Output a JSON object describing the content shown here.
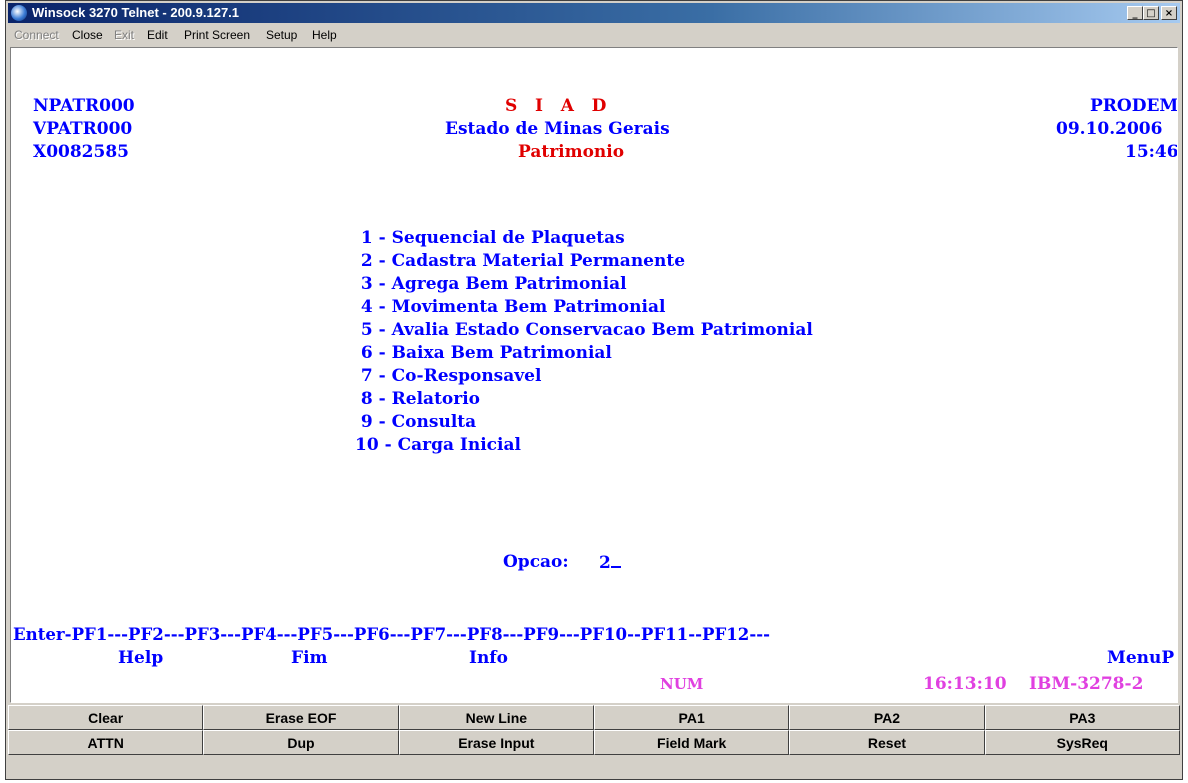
{
  "window": {
    "title": "Winsock 3270 Telnet - 200.9.127.1",
    "controls": {
      "minimize": "_",
      "maximize": "□",
      "close": "×"
    }
  },
  "menu": {
    "connect": "Connect",
    "close": "Close",
    "exit": "Exit",
    "edit": "Edit",
    "print_screen": "Print Screen",
    "setup": "Setup",
    "help": "Help"
  },
  "screen": {
    "header": {
      "left": [
        "NPATR000",
        "VPATR000",
        "X0082585"
      ],
      "center": [
        "S   I   A   D",
        "Estado de Minas Gerais",
        "Patrimonio"
      ],
      "right": [
        "PRODEMGE",
        "09.10.2006",
        "15:46"
      ]
    },
    "menu_options": [
      {
        "num": " 1",
        "label": "Sequencial de Plaquetas"
      },
      {
        "num": " 2",
        "label": "Cadastra Material Permanente"
      },
      {
        "num": " 3",
        "label": "Agrega Bem Patrimonial"
      },
      {
        "num": " 4",
        "label": "Movimenta Bem Patrimonial"
      },
      {
        "num": " 5",
        "label": "Avalia Estado Conservacao Bem Patrimonial"
      },
      {
        "num": " 6",
        "label": "Baixa Bem Patrimonial"
      },
      {
        "num": " 7",
        "label": "Co-Responsavel"
      },
      {
        "num": " 8",
        "label": "Relatorio"
      },
      {
        "num": " 9",
        "label": "Consulta"
      },
      {
        "num": "10",
        "label": "Carga Inicial"
      }
    ],
    "option_prompt": "Opcao:",
    "option_value": "2",
    "pf_line": "Enter-PF1---PF2---PF3---PF4---PF5---PF6---PF7---PF8---PF9---PF10--PF11--PF12---",
    "pf_help": "Help",
    "pf_fim": "Fim",
    "pf_info": "Info",
    "pf_menup": "MenuP"
  },
  "status": {
    "num": "NUM",
    "time": "16:13:10",
    "terminal_type": "IBM-3278-2"
  },
  "keypad": {
    "row1": [
      "Clear",
      "Erase EOF",
      "New Line",
      "PA1",
      "PA2",
      "PA3"
    ],
    "row2": [
      "ATTN",
      "Dup",
      "Erase Input",
      "Field Mark",
      "Reset",
      "SysReq"
    ]
  },
  "colors": {
    "field_protected": "#0000ff",
    "highlight": "#e00000",
    "status": "#e040e0",
    "titlebar": "#0a246a"
  }
}
